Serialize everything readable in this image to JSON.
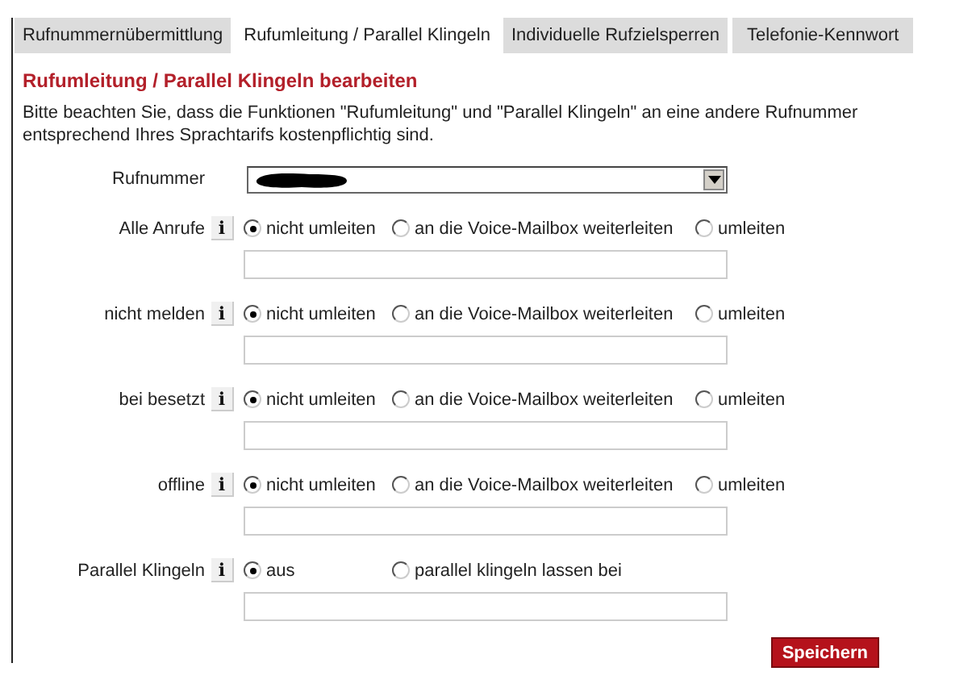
{
  "tabs": [
    {
      "label": "Rufnummernübermittlung",
      "selected": false
    },
    {
      "label": "Rufumleitung / Parallel Klingeln",
      "selected": true
    },
    {
      "label": "Individuelle Rufzielsperren",
      "selected": false
    },
    {
      "label": "Telefonie-Kennwort",
      "selected": false
    }
  ],
  "heading": "Rufumleitung / Parallel Klingeln bearbeiten",
  "notice": "Bitte beachten Sie, dass die Funktionen \"Rufumleitung\" und \"Parallel Klingeln\" an eine andere Rufnummer entsprechend Ihres Sprachtarifs kostenpflichtig sind.",
  "number_select": {
    "label": "Rufnummer",
    "redacted": true
  },
  "rows": [
    {
      "label": "Alle Anrufe",
      "info": "i",
      "options": [
        {
          "label": "nicht umleiten",
          "selected": true
        },
        {
          "label": "an die Voice-Mailbox weiterleiten",
          "selected": false
        },
        {
          "label": "umleiten",
          "selected": false
        }
      ]
    },
    {
      "label": "nicht melden",
      "info": "i",
      "options": [
        {
          "label": "nicht umleiten",
          "selected": true
        },
        {
          "label": "an die Voice-Mailbox weiterleiten",
          "selected": false
        },
        {
          "label": "umleiten",
          "selected": false
        }
      ]
    },
    {
      "label": "bei besetzt",
      "info": "i",
      "options": [
        {
          "label": "nicht umleiten",
          "selected": true
        },
        {
          "label": "an die Voice-Mailbox weiterleiten",
          "selected": false
        },
        {
          "label": "umleiten",
          "selected": false
        }
      ]
    },
    {
      "label": "offline",
      "info": "i",
      "options": [
        {
          "label": "nicht umleiten",
          "selected": true
        },
        {
          "label": "an die Voice-Mailbox weiterleiten",
          "selected": false
        },
        {
          "label": "umleiten",
          "selected": false
        }
      ]
    },
    {
      "label": "Parallel Klingeln",
      "info": "i",
      "options": [
        {
          "label": "aus",
          "selected": true
        },
        {
          "label": "parallel klingeln lassen bei",
          "selected": false
        }
      ]
    }
  ],
  "save_button": "Speichern"
}
